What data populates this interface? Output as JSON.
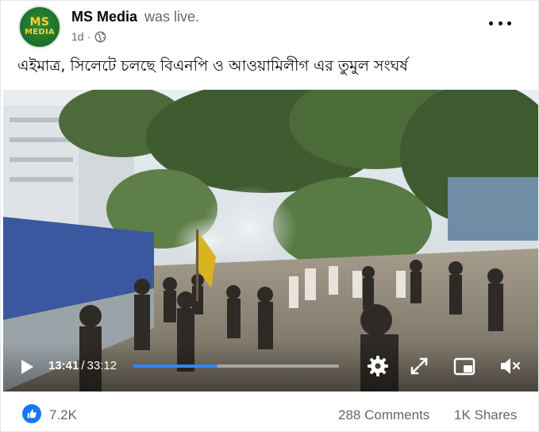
{
  "post": {
    "author": "MS Media",
    "status": "was live.",
    "time": "1d",
    "separator": "·",
    "avatar": {
      "line1": "MS",
      "line2": "MEDIA",
      "bg": "#1f6e2b",
      "text_color": "#f6d02f"
    },
    "text": "এইমাত্র, সিলেটে চলছে বিএনপি ও আওয়ামিলীগ এর তুমুল সংঘর্ষ",
    "menu_icon": "more-horizontal-icon",
    "audience_icon": "globe-icon"
  },
  "video": {
    "current_time": "13:41",
    "time_separator": "/",
    "duration": "33:12",
    "progress": 0.41,
    "progress_color": "#2d88ff",
    "icons": [
      "play-icon",
      "settings-gear-icon",
      "fullscreen-expand-icon",
      "picture-in-picture-icon",
      "volume-muted-icon"
    ]
  },
  "reactions": {
    "icon": "like-thumb-icon",
    "count": "7.2K",
    "comments": "288 Comments",
    "shares": "1K Shares",
    "accent": "#1877f2"
  }
}
